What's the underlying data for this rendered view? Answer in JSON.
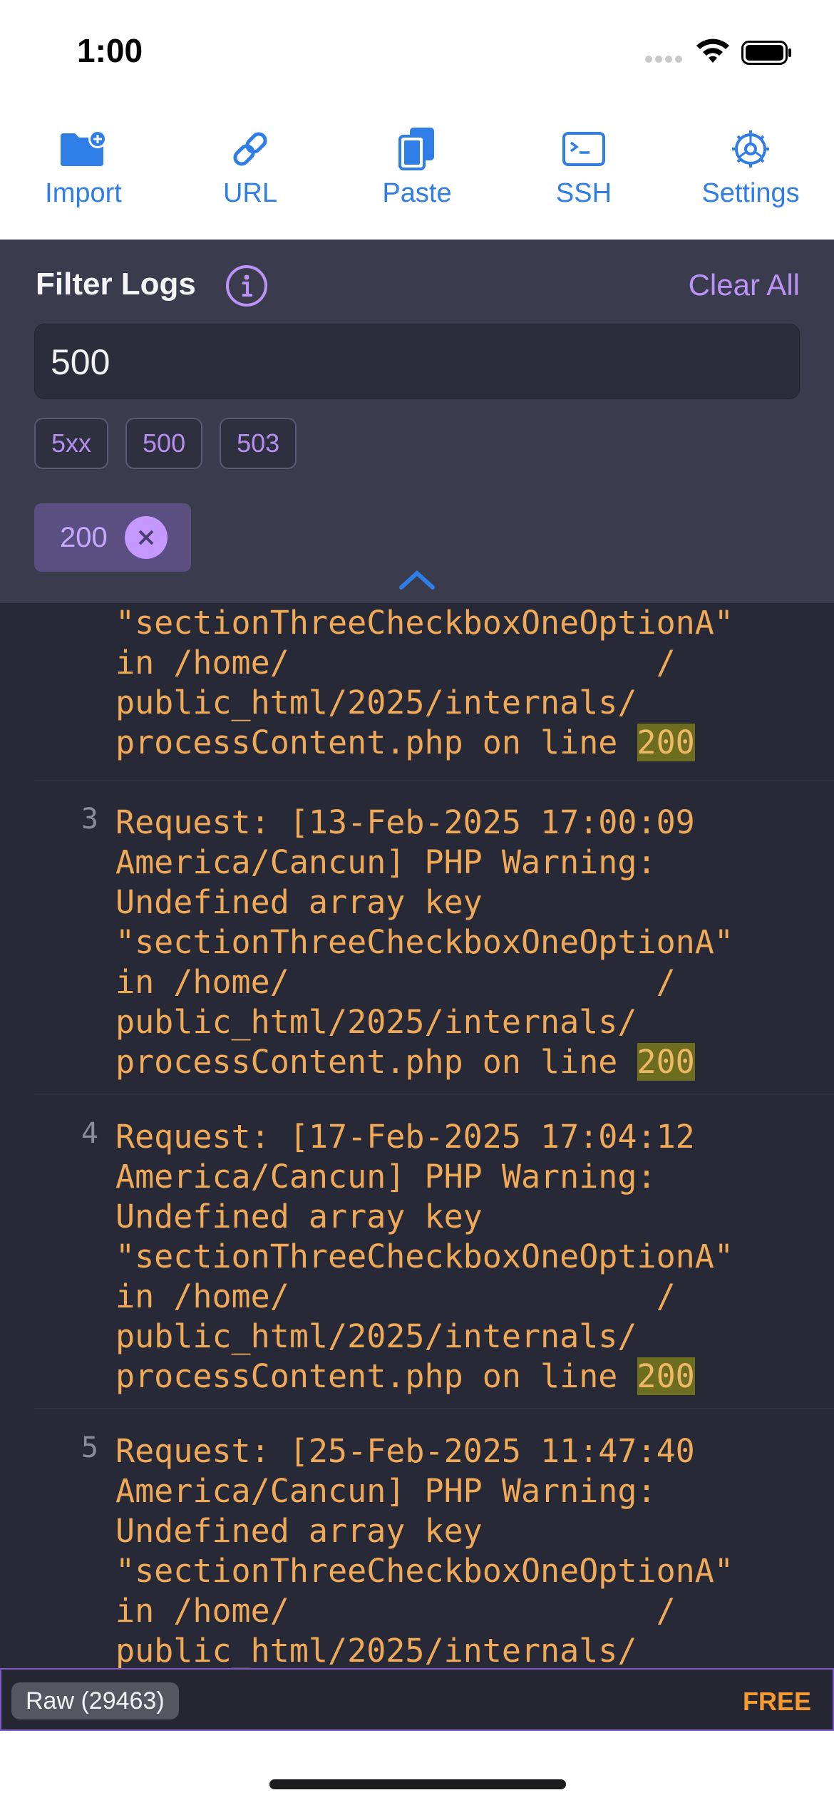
{
  "status_bar": {
    "time": "1:00"
  },
  "toolbar": {
    "items": [
      {
        "label": "Import",
        "icon": "folder-plus-icon"
      },
      {
        "label": "URL",
        "icon": "link-icon"
      },
      {
        "label": "Paste",
        "icon": "paste-icon"
      },
      {
        "label": "SSH",
        "icon": "terminal-icon"
      },
      {
        "label": "Settings",
        "icon": "gear-icon"
      }
    ]
  },
  "filter": {
    "title": "Filter Logs",
    "clear_all": "Clear All",
    "input_value": "500",
    "suggestions": [
      "5xx",
      "500",
      "503"
    ],
    "active_filter": "200"
  },
  "logs": {
    "entries": [
      {
        "number": "",
        "lines": [
          "\"sectionThreeCheckboxOneOptionA\"",
          "in /home/                   /",
          "public_html/2025/internals/"
        ],
        "last_prefix": "processContent.php on line ",
        "highlight": "200"
      },
      {
        "number": "3",
        "lines": [
          "Request: [13-Feb-2025 17:00:09",
          "America/Cancun] PHP Warning:",
          "Undefined array key",
          "\"sectionThreeCheckboxOneOptionA\"",
          "in /home/                   /",
          "public_html/2025/internals/"
        ],
        "last_prefix": "processContent.php on line ",
        "highlight": "200"
      },
      {
        "number": "4",
        "lines": [
          "Request: [17-Feb-2025 17:04:12",
          "America/Cancun] PHP Warning:",
          "Undefined array key",
          "\"sectionThreeCheckboxOneOptionA\"",
          "in /home/                   /",
          "public_html/2025/internals/"
        ],
        "last_prefix": "processContent.php on line ",
        "highlight": "200"
      },
      {
        "number": "5",
        "lines": [
          "Request: [25-Feb-2025 11:47:40",
          "America/Cancun] PHP Warning:",
          "Undefined array key",
          "\"sectionThreeCheckboxOneOptionA\"",
          "in /home/                   /",
          "public_html/2025/internals/"
        ],
        "last_prefix": "",
        "highlight": ""
      }
    ]
  },
  "bottom_bar": {
    "raw_label": "Raw (29463)",
    "plan_label": "FREE"
  },
  "colors": {
    "accent": "#2f7de6",
    "purple": "#bb92f7",
    "log_text": "#f0a956",
    "highlight": "#6d6d1f",
    "free": "#f59b30"
  }
}
